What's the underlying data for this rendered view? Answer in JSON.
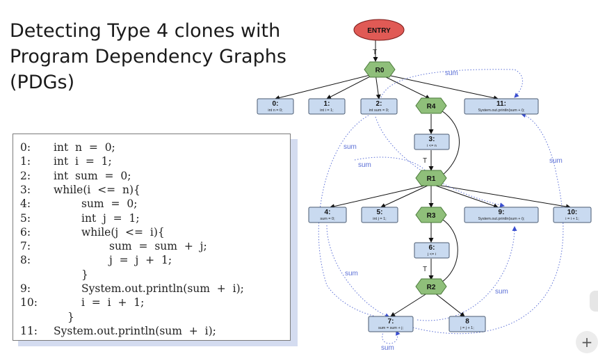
{
  "slide": {
    "title": "Detecting Type 4 clones with Program Dependency Graphs (PDGs)"
  },
  "code": {
    "lines": [
      {
        "n": "0:",
        "text": "int  n  =  0;",
        "indent": 0
      },
      {
        "n": "1:",
        "text": "int  i  =  1;",
        "indent": 0
      },
      {
        "n": "2:",
        "text": "int  sum  =  0;",
        "indent": 0
      },
      {
        "n": "3:",
        "text": "while(i  <=  n){",
        "indent": 0
      },
      {
        "n": "4:",
        "text": "sum  =  0;",
        "indent": 1
      },
      {
        "n": "5:",
        "text": "int  j  =  1;",
        "indent": 1
      },
      {
        "n": "6:",
        "text": "while(j  <=  i){",
        "indent": 1
      },
      {
        "n": "7:",
        "text": "sum  =  sum  +  j;",
        "indent": 2
      },
      {
        "n": "8:",
        "text": "j  =  j  +  1;",
        "indent": 2
      },
      {
        "n": "",
        "text": "}",
        "indent": 1
      },
      {
        "n": "9:",
        "text": "System.out.println(sum  +  i);",
        "indent": 1
      },
      {
        "n": "10:",
        "text": "i  =  i  +  1;",
        "indent": 1
      },
      {
        "n": "",
        "text": "}",
        "indent": 0.5
      },
      {
        "n": "11:",
        "text": "System.out.println(sum  +  i);",
        "indent": 0
      }
    ]
  },
  "graph": {
    "entry": "ENTRY",
    "true_label": "T",
    "data_label": "sum",
    "regions": {
      "r0": "R0",
      "r4": "R4",
      "r1": "R1",
      "r3": "R3",
      "r2": "R2"
    },
    "statements": {
      "s0": {
        "id": "0:",
        "code": "int n = 0;"
      },
      "s1": {
        "id": "1:",
        "code": "int i = 1;"
      },
      "s2": {
        "id": "2:",
        "code": "int sum = 0;"
      },
      "s3": {
        "id": "3:",
        "code": "i <= n"
      },
      "s4": {
        "id": "4:",
        "code": "sum = 0;"
      },
      "s5": {
        "id": "5:",
        "code": "int j = 1;"
      },
      "s6": {
        "id": "6:",
        "code": "j <= i"
      },
      "s7": {
        "id": "7:",
        "code": "sum = sum + j;"
      },
      "s8": {
        "id": "8",
        "code": "j = j + 1;"
      },
      "s9": {
        "id": "9:",
        "code": "System.out.println(sum + i);"
      },
      "s10": {
        "id": "10:",
        "code": "i = i + 1;"
      },
      "s11": {
        "id": "11:",
        "code": "System.out.println(sum + i);"
      }
    },
    "colors": {
      "entry_fill": "#e05a55",
      "region_fill": "#8fbf7a",
      "region_stroke": "#4a7a3a",
      "stmt_fill": "#c9daf0",
      "stmt_stroke": "#4a5a70",
      "data_edge": "#5b6fd6"
    }
  },
  "controls": {
    "add_button": "+"
  }
}
